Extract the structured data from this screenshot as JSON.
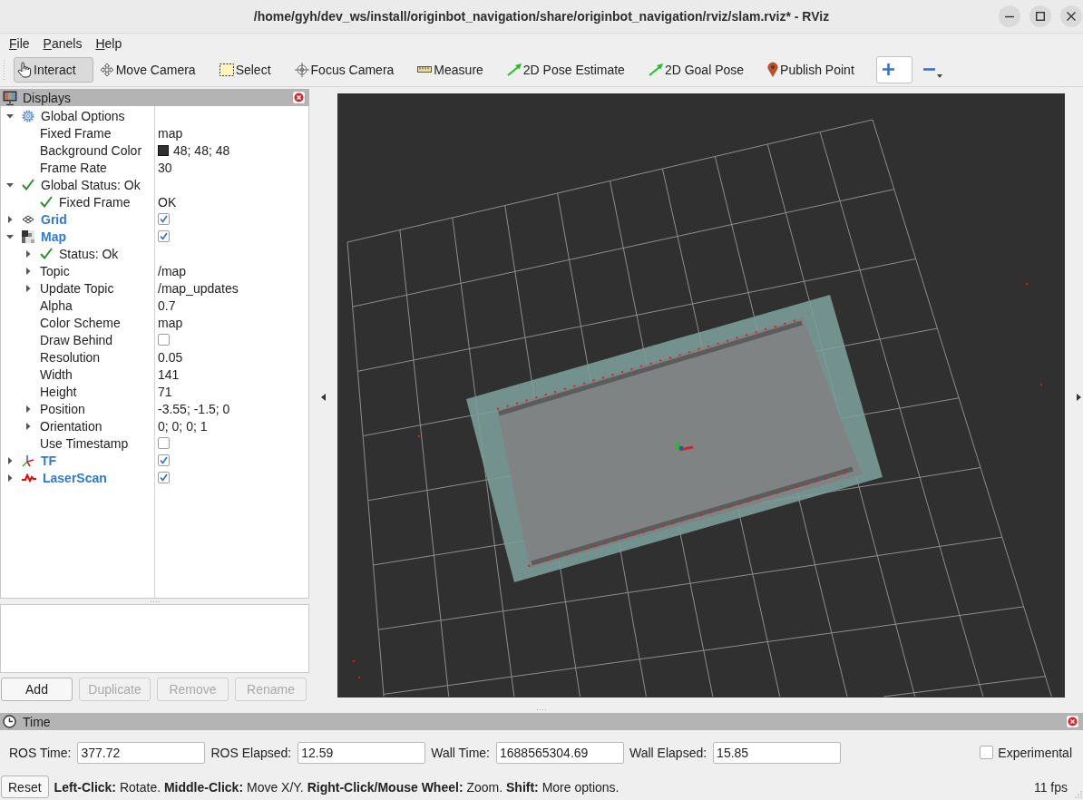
{
  "window": {
    "title": "/home/gyh/dev_ws/install/originbot_navigation/share/originbot_navigation/rviz/slam.rviz* - RViz"
  },
  "menu": [
    {
      "label": "File"
    },
    {
      "label": "Panels"
    },
    {
      "label": "Help"
    }
  ],
  "toolbar": {
    "tools": [
      {
        "kind": "interact",
        "label": "Interact",
        "selected": true
      },
      {
        "kind": "move",
        "label": "Move Camera",
        "selected": false
      },
      {
        "kind": "select",
        "label": "Select",
        "selected": false
      },
      {
        "kind": "focus",
        "label": "Focus Camera",
        "selected": false
      },
      {
        "kind": "measure",
        "label": "Measure",
        "selected": false
      },
      {
        "kind": "pose",
        "label": "2D Pose Estimate",
        "selected": false
      },
      {
        "kind": "goal",
        "label": "2D Goal Pose",
        "selected": false
      },
      {
        "kind": "point",
        "label": "Publish Point",
        "selected": false
      }
    ]
  },
  "displays": {
    "title": "Displays",
    "tree": [
      {
        "kind": "options",
        "label": "Global Options",
        "expanded": true,
        "children": [
          {
            "kind": "property",
            "label": "Fixed Frame",
            "value": "map"
          },
          {
            "kind": "property",
            "label": "Background Color",
            "value": "48; 48; 48",
            "color": "#303030"
          },
          {
            "kind": "property",
            "label": "Frame Rate",
            "value": "30"
          }
        ]
      },
      {
        "kind": "status",
        "label": "Global Status: Ok",
        "expanded": true,
        "children": [
          {
            "kind": "status",
            "label": "Fixed Frame",
            "value": "OK"
          }
        ]
      },
      {
        "kind": "grid",
        "label": "Grid",
        "expanded": false,
        "checked": true
      },
      {
        "kind": "map",
        "label": "Map",
        "expanded": true,
        "checked": true,
        "children": [
          {
            "kind": "status",
            "label": "Status: Ok",
            "expanded": false
          },
          {
            "kind": "property",
            "label": "Topic",
            "value": "/map",
            "expanded": false
          },
          {
            "kind": "property",
            "label": "Update Topic",
            "value": "/map_updates",
            "expanded": false
          },
          {
            "kind": "property",
            "label": "Alpha",
            "value": "0.7"
          },
          {
            "kind": "property",
            "label": "Color Scheme",
            "value": "map"
          },
          {
            "kind": "property",
            "label": "Draw Behind",
            "checked": false
          },
          {
            "kind": "property",
            "label": "Resolution",
            "value": "0.05"
          },
          {
            "kind": "property",
            "label": "Width",
            "value": "141"
          },
          {
            "kind": "property",
            "label": "Height",
            "value": "71"
          },
          {
            "kind": "property",
            "label": "Position",
            "value": "-3.55; -1.5; 0",
            "expanded": false
          },
          {
            "kind": "property",
            "label": "Orientation",
            "value": "0; 0; 0; 1",
            "expanded": false
          },
          {
            "kind": "property",
            "label": "Use Timestamp",
            "checked": false
          }
        ]
      },
      {
        "kind": "tf",
        "label": "TF",
        "expanded": false,
        "checked": true
      },
      {
        "kind": "scan",
        "label": "LaserScan",
        "expanded": false,
        "checked": true
      }
    ],
    "buttons": [
      {
        "label": "Add",
        "disabled": false
      },
      {
        "label": "Duplicate",
        "disabled": true
      },
      {
        "label": "Remove",
        "disabled": true
      },
      {
        "label": "Rename",
        "disabled": true
      }
    ]
  },
  "time_panel": {
    "title": "Time",
    "fields": [
      {
        "label": "ROS Time:",
        "value": "377.72"
      },
      {
        "label": "ROS Elapsed:",
        "value": "12.59"
      },
      {
        "label": "Wall Time:",
        "value": "1688565304.69"
      },
      {
        "label": "Wall Elapsed:",
        "value": "15.85"
      }
    ],
    "experimental": {
      "label": "Experimental",
      "checked": false
    }
  },
  "status_bar": {
    "reset": "Reset",
    "hint": "**Left-Click:** Rotate. **Middle-Click:** Move X/Y. **Right-Click/Mouse Wheel:** Zoom. **Shift:** More options.",
    "fps": "11 fps"
  }
}
